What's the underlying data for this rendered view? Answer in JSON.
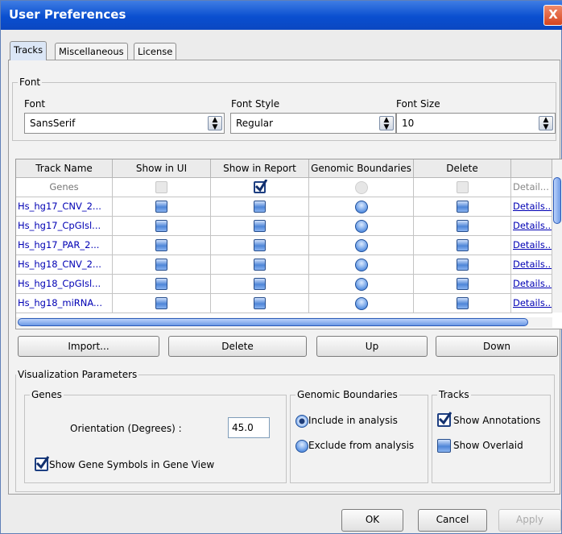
{
  "window": {
    "title": "User Preferences",
    "close_label": "X"
  },
  "tabs": [
    {
      "label": "Tracks",
      "active": true
    },
    {
      "label": "Miscellaneous",
      "active": false
    },
    {
      "label": "License",
      "active": false
    }
  ],
  "font": {
    "group_label": "Font",
    "font_label": "Font",
    "font_value": "SansSerif",
    "style_label": "Font Style",
    "style_value": "Regular",
    "size_label": "Font Size",
    "size_value": "10"
  },
  "track_table": {
    "columns": [
      "Track Name",
      "Show in UI",
      "Show in Report",
      "Genomic Boundaries",
      "Delete",
      ""
    ],
    "rows": [
      {
        "name": "Genes",
        "details": "Detail...",
        "disabled": true,
        "show_in_ui": true,
        "show_in_report": true,
        "genomic_boundaries": false,
        "delete": false
      },
      {
        "name": "Hs_hg17_CNV_2...",
        "details": "Details...",
        "disabled": false,
        "show_in_ui": false,
        "show_in_report": false,
        "genomic_boundaries": false,
        "delete": false
      },
      {
        "name": "Hs_hg17_CpGIsl...",
        "details": "Details...",
        "disabled": false,
        "show_in_ui": false,
        "show_in_report": false,
        "genomic_boundaries": false,
        "delete": false
      },
      {
        "name": "Hs_hg17_PAR_2...",
        "details": "Details...",
        "disabled": false,
        "show_in_ui": false,
        "show_in_report": false,
        "genomic_boundaries": false,
        "delete": false
      },
      {
        "name": "Hs_hg18_CNV_2...",
        "details": "Details...",
        "disabled": false,
        "show_in_ui": false,
        "show_in_report": false,
        "genomic_boundaries": false,
        "delete": false
      },
      {
        "name": "Hs_hg18_CpGIsl...",
        "details": "Details...",
        "disabled": false,
        "show_in_ui": false,
        "show_in_report": false,
        "genomic_boundaries": false,
        "delete": false
      },
      {
        "name": "Hs_hg18_miRNA...",
        "details": "Details...",
        "disabled": false,
        "show_in_ui": false,
        "show_in_report": false,
        "genomic_boundaries": false,
        "delete": false
      }
    ]
  },
  "table_buttons": {
    "import": "Import...",
    "delete": "Delete",
    "up": "Up",
    "down": "Down"
  },
  "visualization": {
    "group_label": "Visualization Parameters",
    "genes": {
      "group_label": "Genes",
      "orientation_label": "Orientation (Degrees) :",
      "orientation_value": "45.0",
      "show_symbols_label": "Show Gene Symbols in Gene View",
      "show_symbols_checked": true
    },
    "genomic_boundaries": {
      "group_label": "Genomic Boundaries",
      "include_label": "Include in analysis",
      "exclude_label": "Exclude from analysis",
      "selected": "include"
    },
    "tracks": {
      "group_label": "Tracks",
      "show_annotations_label": "Show Annotations",
      "show_annotations_checked": true,
      "show_overlaid_label": "Show Overlaid",
      "show_overlaid_checked": false
    }
  },
  "dialog_buttons": {
    "ok": "OK",
    "cancel": "Cancel",
    "apply": "Apply"
  },
  "colors": {
    "title_bar": "#0a4fd0",
    "link": "#0000b4",
    "accent": "#4f86d8"
  }
}
